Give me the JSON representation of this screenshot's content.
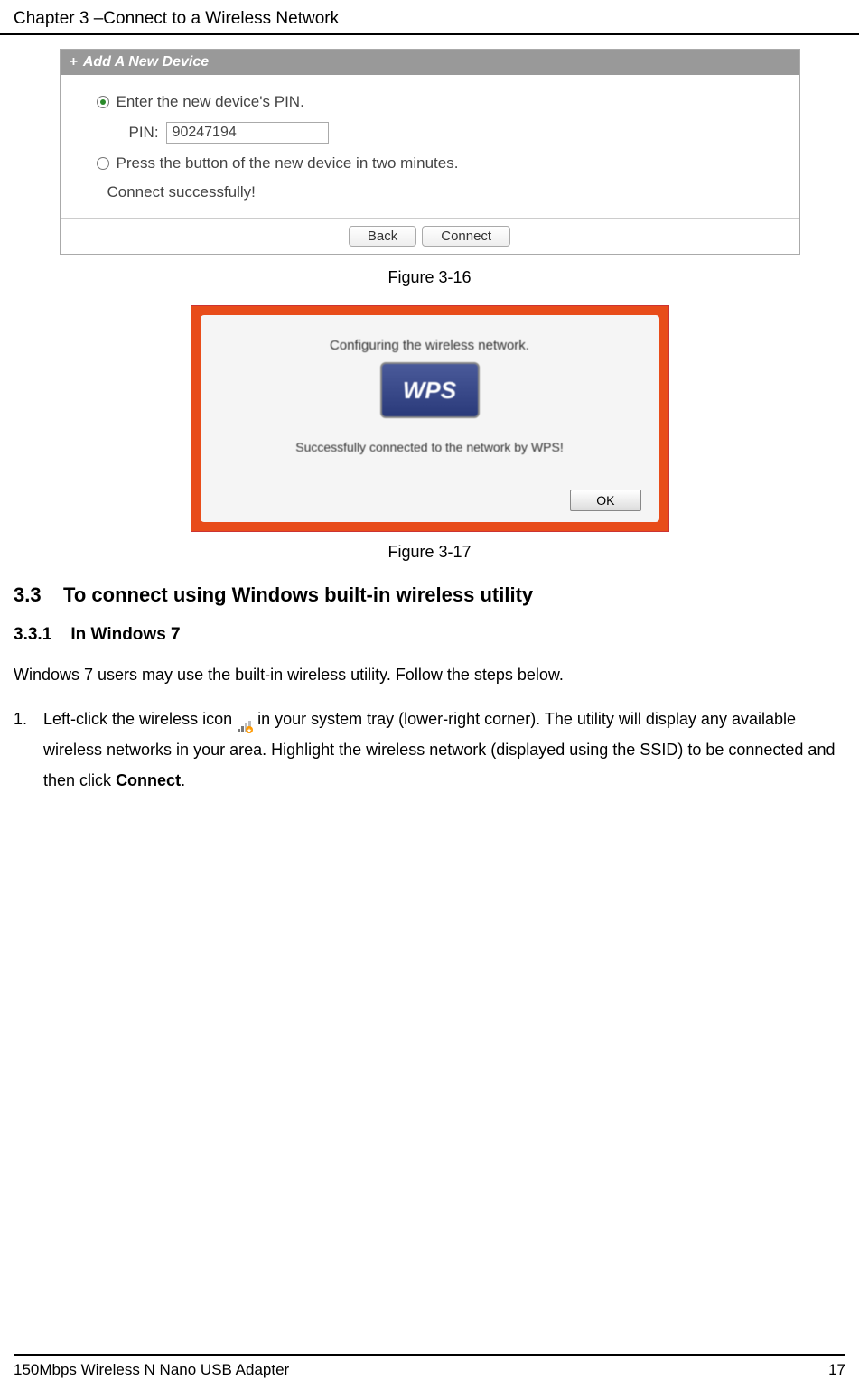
{
  "header": {
    "chapter_title": "Chapter 3 –Connect to a Wireless Network"
  },
  "dialog1": {
    "title": "Add A New Device",
    "radio1_label": "Enter the new device's PIN.",
    "pin_label": "PIN:",
    "pin_value": "90247194",
    "radio2_label": "Press the button of the new device in two minutes.",
    "connect_message": "Connect successfully!",
    "back_button": "Back",
    "connect_button": "Connect"
  },
  "caption1": "Figure 3-16",
  "wps_dialog": {
    "config_text": "Configuring the wireless network.",
    "logo_text": "WPS",
    "success_text": "Successfully connected to the network by WPS!",
    "ok_button": "OK"
  },
  "caption2": "Figure 3-17",
  "section": {
    "number": "3.3",
    "title": "To connect using Windows built-in wireless utility"
  },
  "subsection": {
    "number": "3.3.1",
    "title": "In Windows 7"
  },
  "intro_text": "Windows 7 users may use the built-in wireless utility. Follow the steps below.",
  "step1": {
    "number": "1.",
    "text_before_icon": "Left-click the wireless icon ",
    "text_after_icon": " in your system tray (lower-right corner). The utility will display any available wireless networks in your area. Highlight the wireless network (displayed using the SSID) to be connected and then click ",
    "bold_word": "Connect",
    "text_end": "."
  },
  "footer": {
    "product": "150Mbps Wireless N Nano USB Adapter",
    "page": "17"
  }
}
